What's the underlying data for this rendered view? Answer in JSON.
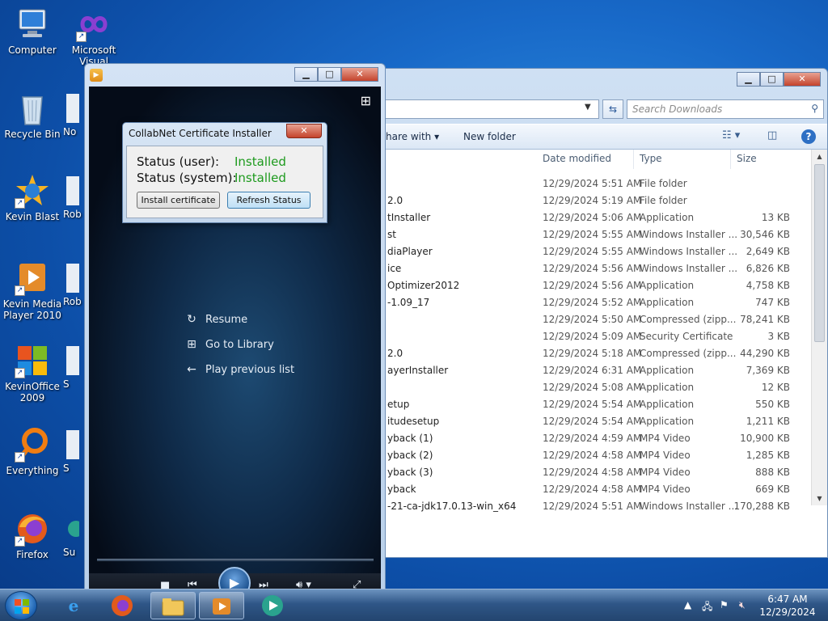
{
  "desktop": {
    "icons": [
      {
        "label": "Computer"
      },
      {
        "label": "Microsoft Visual"
      },
      {
        "label": "Recycle Bin"
      },
      {
        "label": "No"
      },
      {
        "label": "Kevin Blast"
      },
      {
        "label": "Rob"
      },
      {
        "label": "Kevin Media Player 2010"
      },
      {
        "label": "Rob"
      },
      {
        "label": "KevinOffice 2009"
      },
      {
        "label": "S"
      },
      {
        "label": "Everything"
      },
      {
        "label": "S"
      },
      {
        "label": "Firefox"
      },
      {
        "label": "Su"
      }
    ]
  },
  "explorer": {
    "search_placeholder": "Search Downloads",
    "share_with": "hare with",
    "new_folder": "New folder",
    "columns": {
      "date": "Date modified",
      "type": "Type",
      "size": "Size"
    },
    "rows": [
      {
        "name": "",
        "date": "12/29/2024 5:51 AM",
        "type": "File folder",
        "size": ""
      },
      {
        "name": "2.0",
        "date": "12/29/2024 5:19 AM",
        "type": "File folder",
        "size": ""
      },
      {
        "name": "tInstaller",
        "date": "12/29/2024 5:06 AM",
        "type": "Application",
        "size": "13 KB"
      },
      {
        "name": "st",
        "date": "12/29/2024 5:55 AM",
        "type": "Windows Installer ...",
        "size": "30,546 KB"
      },
      {
        "name": "diaPlayer",
        "date": "12/29/2024 5:55 AM",
        "type": "Windows Installer ...",
        "size": "2,649 KB"
      },
      {
        "name": "ice",
        "date": "12/29/2024 5:56 AM",
        "type": "Windows Installer ...",
        "size": "6,826 KB"
      },
      {
        "name": "Optimizer2012",
        "date": "12/29/2024 5:56 AM",
        "type": "Application",
        "size": "4,758 KB"
      },
      {
        "name": "-1.09_17",
        "date": "12/29/2024 5:52 AM",
        "type": "Application",
        "size": "747 KB"
      },
      {
        "name": "",
        "date": "12/29/2024 5:50 AM",
        "type": "Compressed (zipp...",
        "size": "78,241 KB"
      },
      {
        "name": "",
        "date": "12/29/2024 5:09 AM",
        "type": "Security Certificate",
        "size": "3 KB"
      },
      {
        "name": "2.0",
        "date": "12/29/2024 5:18 AM",
        "type": "Compressed (zipp...",
        "size": "44,290 KB"
      },
      {
        "name": "ayerInstaller",
        "date": "12/29/2024 6:31 AM",
        "type": "Application",
        "size": "7,369 KB"
      },
      {
        "name": "",
        "date": "12/29/2024 5:08 AM",
        "type": "Application",
        "size": "12 KB"
      },
      {
        "name": "etup",
        "date": "12/29/2024 5:54 AM",
        "type": "Application",
        "size": "550 KB"
      },
      {
        "name": "itudesetup",
        "date": "12/29/2024 5:54 AM",
        "type": "Application",
        "size": "1,211 KB"
      },
      {
        "name": "yback (1)",
        "date": "12/29/2024 4:59 AM",
        "type": "MP4 Video",
        "size": "10,900 KB"
      },
      {
        "name": "yback (2)",
        "date": "12/29/2024 4:58 AM",
        "type": "MP4 Video",
        "size": "1,285 KB"
      },
      {
        "name": "yback (3)",
        "date": "12/29/2024 4:58 AM",
        "type": "MP4 Video",
        "size": "888 KB"
      },
      {
        "name": "yback",
        "date": "12/29/2024 4:58 AM",
        "type": "MP4 Video",
        "size": "669 KB"
      },
      {
        "name": "-21-ca-jdk17.0.13-win_x64",
        "date": "12/29/2024 5:51 AM",
        "type": "Windows Installer ...",
        "size": "170,288 KB"
      }
    ]
  },
  "media_player": {
    "menu": [
      {
        "icon": "resume-icon",
        "label": "Resume"
      },
      {
        "icon": "library-icon",
        "label": "Go to Library"
      },
      {
        "icon": "back-arrow-icon",
        "label": "Play previous list"
      }
    ]
  },
  "dialog": {
    "title": "CollabNet Certificate Installer",
    "status_user_label": "Status (user):",
    "status_user_value": "Installed",
    "status_system_label": "Status (system):",
    "status_system_value": "Installed",
    "install_button": "Install certificate",
    "refresh_button": "Refresh Status"
  },
  "taskbar": {
    "time": "6:47 AM",
    "date": "12/29/2024"
  },
  "colors": {
    "installed_green": "#1d9a1d",
    "desktop_blue": "#1869c8"
  }
}
